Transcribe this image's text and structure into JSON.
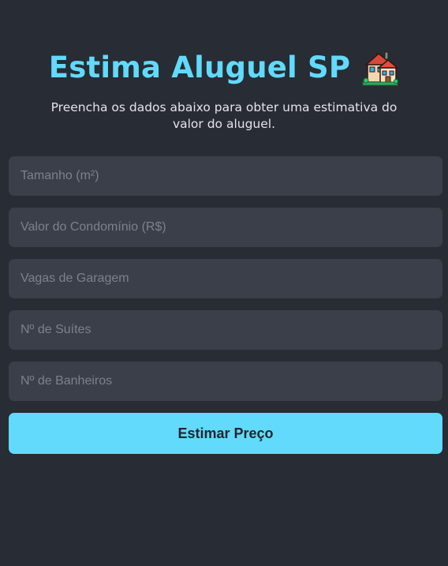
{
  "header": {
    "title": "Estima Aluguel SP",
    "title_icon": "house-with-garden-emoji",
    "subtitle": "Preencha os dados abaixo para obter uma estimativa do valor do aluguel."
  },
  "form": {
    "fields": [
      {
        "name": "tamanho",
        "placeholder": "Tamanho (m²)",
        "value": ""
      },
      {
        "name": "condominio",
        "placeholder": "Valor do Condomínio (R$)",
        "value": ""
      },
      {
        "name": "vagas",
        "placeholder": "Vagas de Garagem",
        "value": ""
      },
      {
        "name": "suites",
        "placeholder": "Nº de Suítes",
        "value": ""
      },
      {
        "name": "banheiros",
        "placeholder": "Nº de Banheiros",
        "value": ""
      }
    ],
    "submit_label": "Estimar Preço"
  },
  "colors": {
    "background": "#282c34",
    "accent": "#61dafb",
    "input_background": "#3a3f4a",
    "placeholder": "#7d818b"
  }
}
